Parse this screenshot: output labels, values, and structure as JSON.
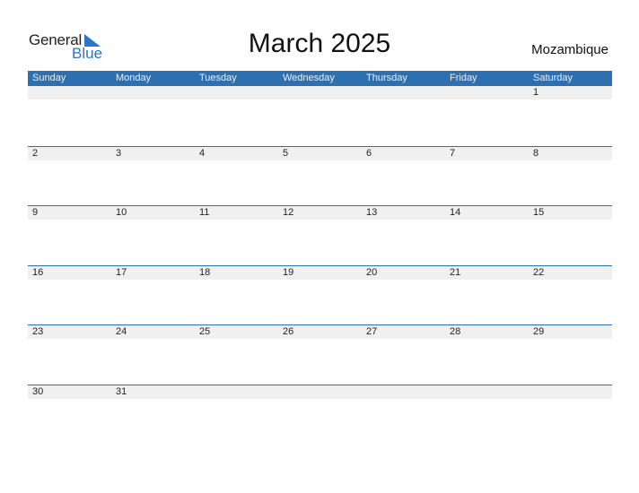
{
  "logo": {
    "text_general": "General",
    "text_blue": "Blue"
  },
  "title": "March 2025",
  "country": "Mozambique",
  "colors": {
    "header_bg": "#2e6fb0",
    "accent": "#2e75c9",
    "date_row_bg": "#f0f0f0"
  },
  "weekdays": [
    "Sunday",
    "Monday",
    "Tuesday",
    "Wednesday",
    "Thursday",
    "Friday",
    "Saturday"
  ],
  "weeks": [
    [
      "",
      "",
      "",
      "",
      "",
      "",
      "1"
    ],
    [
      "2",
      "3",
      "4",
      "5",
      "6",
      "7",
      "8"
    ],
    [
      "9",
      "10",
      "11",
      "12",
      "13",
      "14",
      "15"
    ],
    [
      "16",
      "17",
      "18",
      "19",
      "20",
      "21",
      "22"
    ],
    [
      "23",
      "24",
      "25",
      "26",
      "27",
      "28",
      "29"
    ],
    [
      "30",
      "31",
      "",
      "",
      "",
      "",
      ""
    ]
  ]
}
